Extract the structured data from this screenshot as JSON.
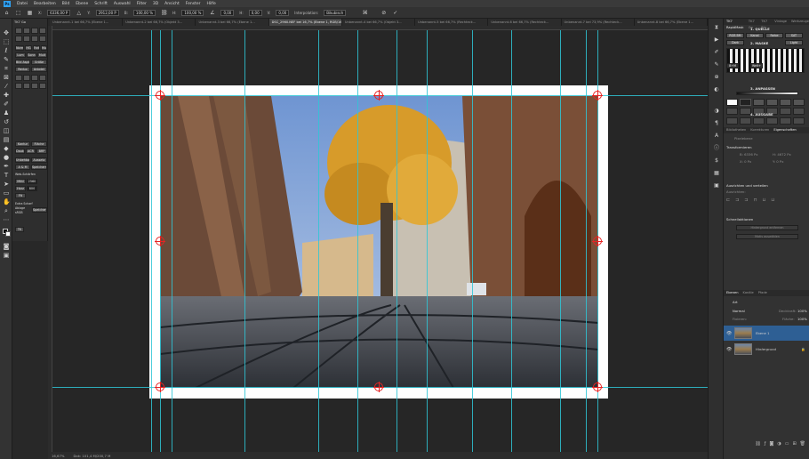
{
  "app": {
    "logo_text": "Ps"
  },
  "menu": [
    "Datei",
    "Bearbeiten",
    "Bild",
    "Ebene",
    "Schrift",
    "Auswahl",
    "Filter",
    "3D",
    "Ansicht",
    "Fenster",
    "Hilfe"
  ],
  "options_bar": {
    "x_value": "6336,00 P",
    "y_value": "2912,00 P",
    "w_value": "100,00 %",
    "h_value": "100,00 %",
    "angle_value": "0,00",
    "h_skew": "0,00",
    "v_skew": "0,00",
    "interpolation_label": "Interpolation:",
    "interpolation_value": "Bikubisch"
  },
  "tabs": [
    "Unbenannt-1 bei 66,7% (Ebene 1...",
    "Unbenannt-2 bei 66,7% (Objekt 3...",
    "Unbenannt-3 bei 66,7% (Ebene 1...",
    "DSC_2960.NEF bei 16,7% (Ebene 1, RGB/16) *",
    "Unbenannt-4 bei 66,7% (Objekt 3...",
    "Unbenannt-5 bei 66,7% (Rechteck...",
    "Unbenannt-6 bei 66,7% (Rechteck...",
    "Unbenannt-7 bei 73,9% (Rechteck...",
    "Unbenannt-8 bei 66,7% (Ebene 1..."
  ],
  "active_tab_index": 3,
  "plugin_panel": {
    "title": "TK7 Go",
    "buttons": [
      "Norm",
      "HG",
      "Farbe",
      "Mult",
      "Lum HL",
      "Sonn",
      "Mult",
      "Bild Aspt",
      "Größe",
      "Redux",
      "Anbdet",
      "Kontur",
      "Fläche",
      "Dauk",
      "ACR",
      "BRP",
      "Unbehbare",
      "Aussetz",
      "A & M",
      "Speichern",
      "Web-Schärfen",
      "Mittl",
      "2560",
      "Horz",
      "800",
      "Fit",
      "Extra Scharf",
      "Ablage",
      "Speichern",
      "sRGB",
      "TK"
    ]
  },
  "status_bar": {
    "zoom": "16,67%",
    "doc_info": "Dok: 101,4 M/200,7 M"
  },
  "right_panel": {
    "top_tabs": [
      "TK7 RapidMask",
      "TK7 Go",
      "TK7 Bin",
      "Vintage",
      "Werkzeuge"
    ],
    "header": "1. QUELLE",
    "source_row": [
      "RGB BM",
      "Kanal",
      "Farbe",
      "SAT"
    ],
    "mask_label": "2. MASKE",
    "mask_row": [
      "Dark",
      "Light"
    ],
    "filter_label": "3. ANPASSEN",
    "output_label": "4. AUSGABE",
    "num_labels": [
      "B+M",
      "Welt+"
    ],
    "props_tabs": [
      "Bibliotheken",
      "Korrekturen",
      "Eigenschaften"
    ],
    "pixel_layer_label": "Pixelebene",
    "transform_title": "Transformieren",
    "transform_b": "B: 6336 Px",
    "transform_h": "H: 4672 Px",
    "transform_x": "X: 0 Px",
    "transform_y": "Y: 0 Px",
    "align_title": "Ausrichten und verteilen",
    "align_sub": "Ausrichten:",
    "quick_title": "Schnellaktionen",
    "quick_btn1": "Hintergrund entfernen",
    "quick_btn2": "Motiv auswählen",
    "layers_tabs": [
      "Ebenen",
      "Kanäle",
      "Pfade"
    ],
    "search_label": "Art",
    "blend_mode": "Normal",
    "opacity_label": "Deckkraft:",
    "opacity_value": "100%",
    "lock_label": "Fixieren:",
    "fill_label": "Fläche:",
    "fill_value": "100%",
    "layers": [
      {
        "name": "Ebene 1",
        "selected": true
      },
      {
        "name": "Hintergrund",
        "selected": false
      }
    ]
  }
}
